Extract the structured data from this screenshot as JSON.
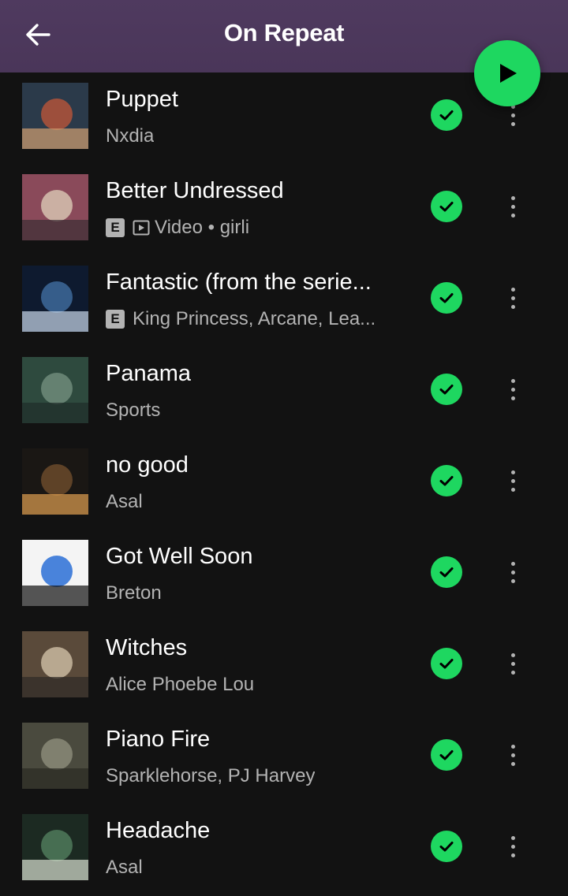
{
  "header": {
    "title": "On Repeat",
    "back_icon": "arrow-left-icon",
    "play_icon": "play-icon",
    "background_color": "#4f3a5f"
  },
  "colors": {
    "accent": "#1ed760",
    "background": "#121212",
    "secondary_text": "#b3b3b3"
  },
  "tracks": [
    {
      "title": "Puppet",
      "subtitle": "Nxdia",
      "explicit": false,
      "video": false,
      "downloaded": true,
      "art_colors": [
        "#2b3a4a",
        "#b2533a",
        "#d3a070"
      ]
    },
    {
      "title": "Better Undressed",
      "explicit_label": "E",
      "video_label": "Video",
      "subtitle": "Video • girli",
      "explicit": true,
      "video": true,
      "downloaded": true,
      "art_colors": [
        "#8a4a5a",
        "#d6c2b0",
        "#3b2e33"
      ]
    },
    {
      "title": "Fantastic (from the serie...",
      "explicit_label": "E",
      "subtitle": "King Princess, Arcane, Lea...",
      "explicit": true,
      "video": false,
      "downloaded": true,
      "art_colors": [
        "#0e1a2f",
        "#3d6a9a",
        "#c9d8ea"
      ]
    },
    {
      "title": "Panama",
      "subtitle": "Sports",
      "explicit": false,
      "video": false,
      "downloaded": true,
      "art_colors": [
        "#2e4a3e",
        "#6f8b7a",
        "#1f2c2a"
      ]
    },
    {
      "title": "no good",
      "subtitle": "Asal",
      "explicit": false,
      "video": false,
      "downloaded": true,
      "art_colors": [
        "#1a1714",
        "#6b4a2a",
        "#e0a050"
      ]
    },
    {
      "title": "Got Well Soon",
      "subtitle": "Breton",
      "explicit": false,
      "video": false,
      "downloaded": true,
      "art_colors": [
        "#f4f4f4",
        "#2a6fd6",
        "#101010"
      ]
    },
    {
      "title": "Witches",
      "subtitle": "Alice Phoebe Lou",
      "explicit": false,
      "video": false,
      "downloaded": true,
      "art_colors": [
        "#5a4a3a",
        "#c9b8a0",
        "#2e2a26"
      ]
    },
    {
      "title": "Piano Fire",
      "subtitle": "Sparklehorse, PJ Harvey",
      "explicit": false,
      "video": false,
      "downloaded": true,
      "art_colors": [
        "#4a4a3e",
        "#8a8a78",
        "#2a2a22"
      ]
    },
    {
      "title": "Headache",
      "subtitle": "Asal",
      "explicit": false,
      "video": false,
      "downloaded": true,
      "art_colors": [
        "#1c2a22",
        "#4f7a5a",
        "#d8e0d0"
      ]
    }
  ]
}
